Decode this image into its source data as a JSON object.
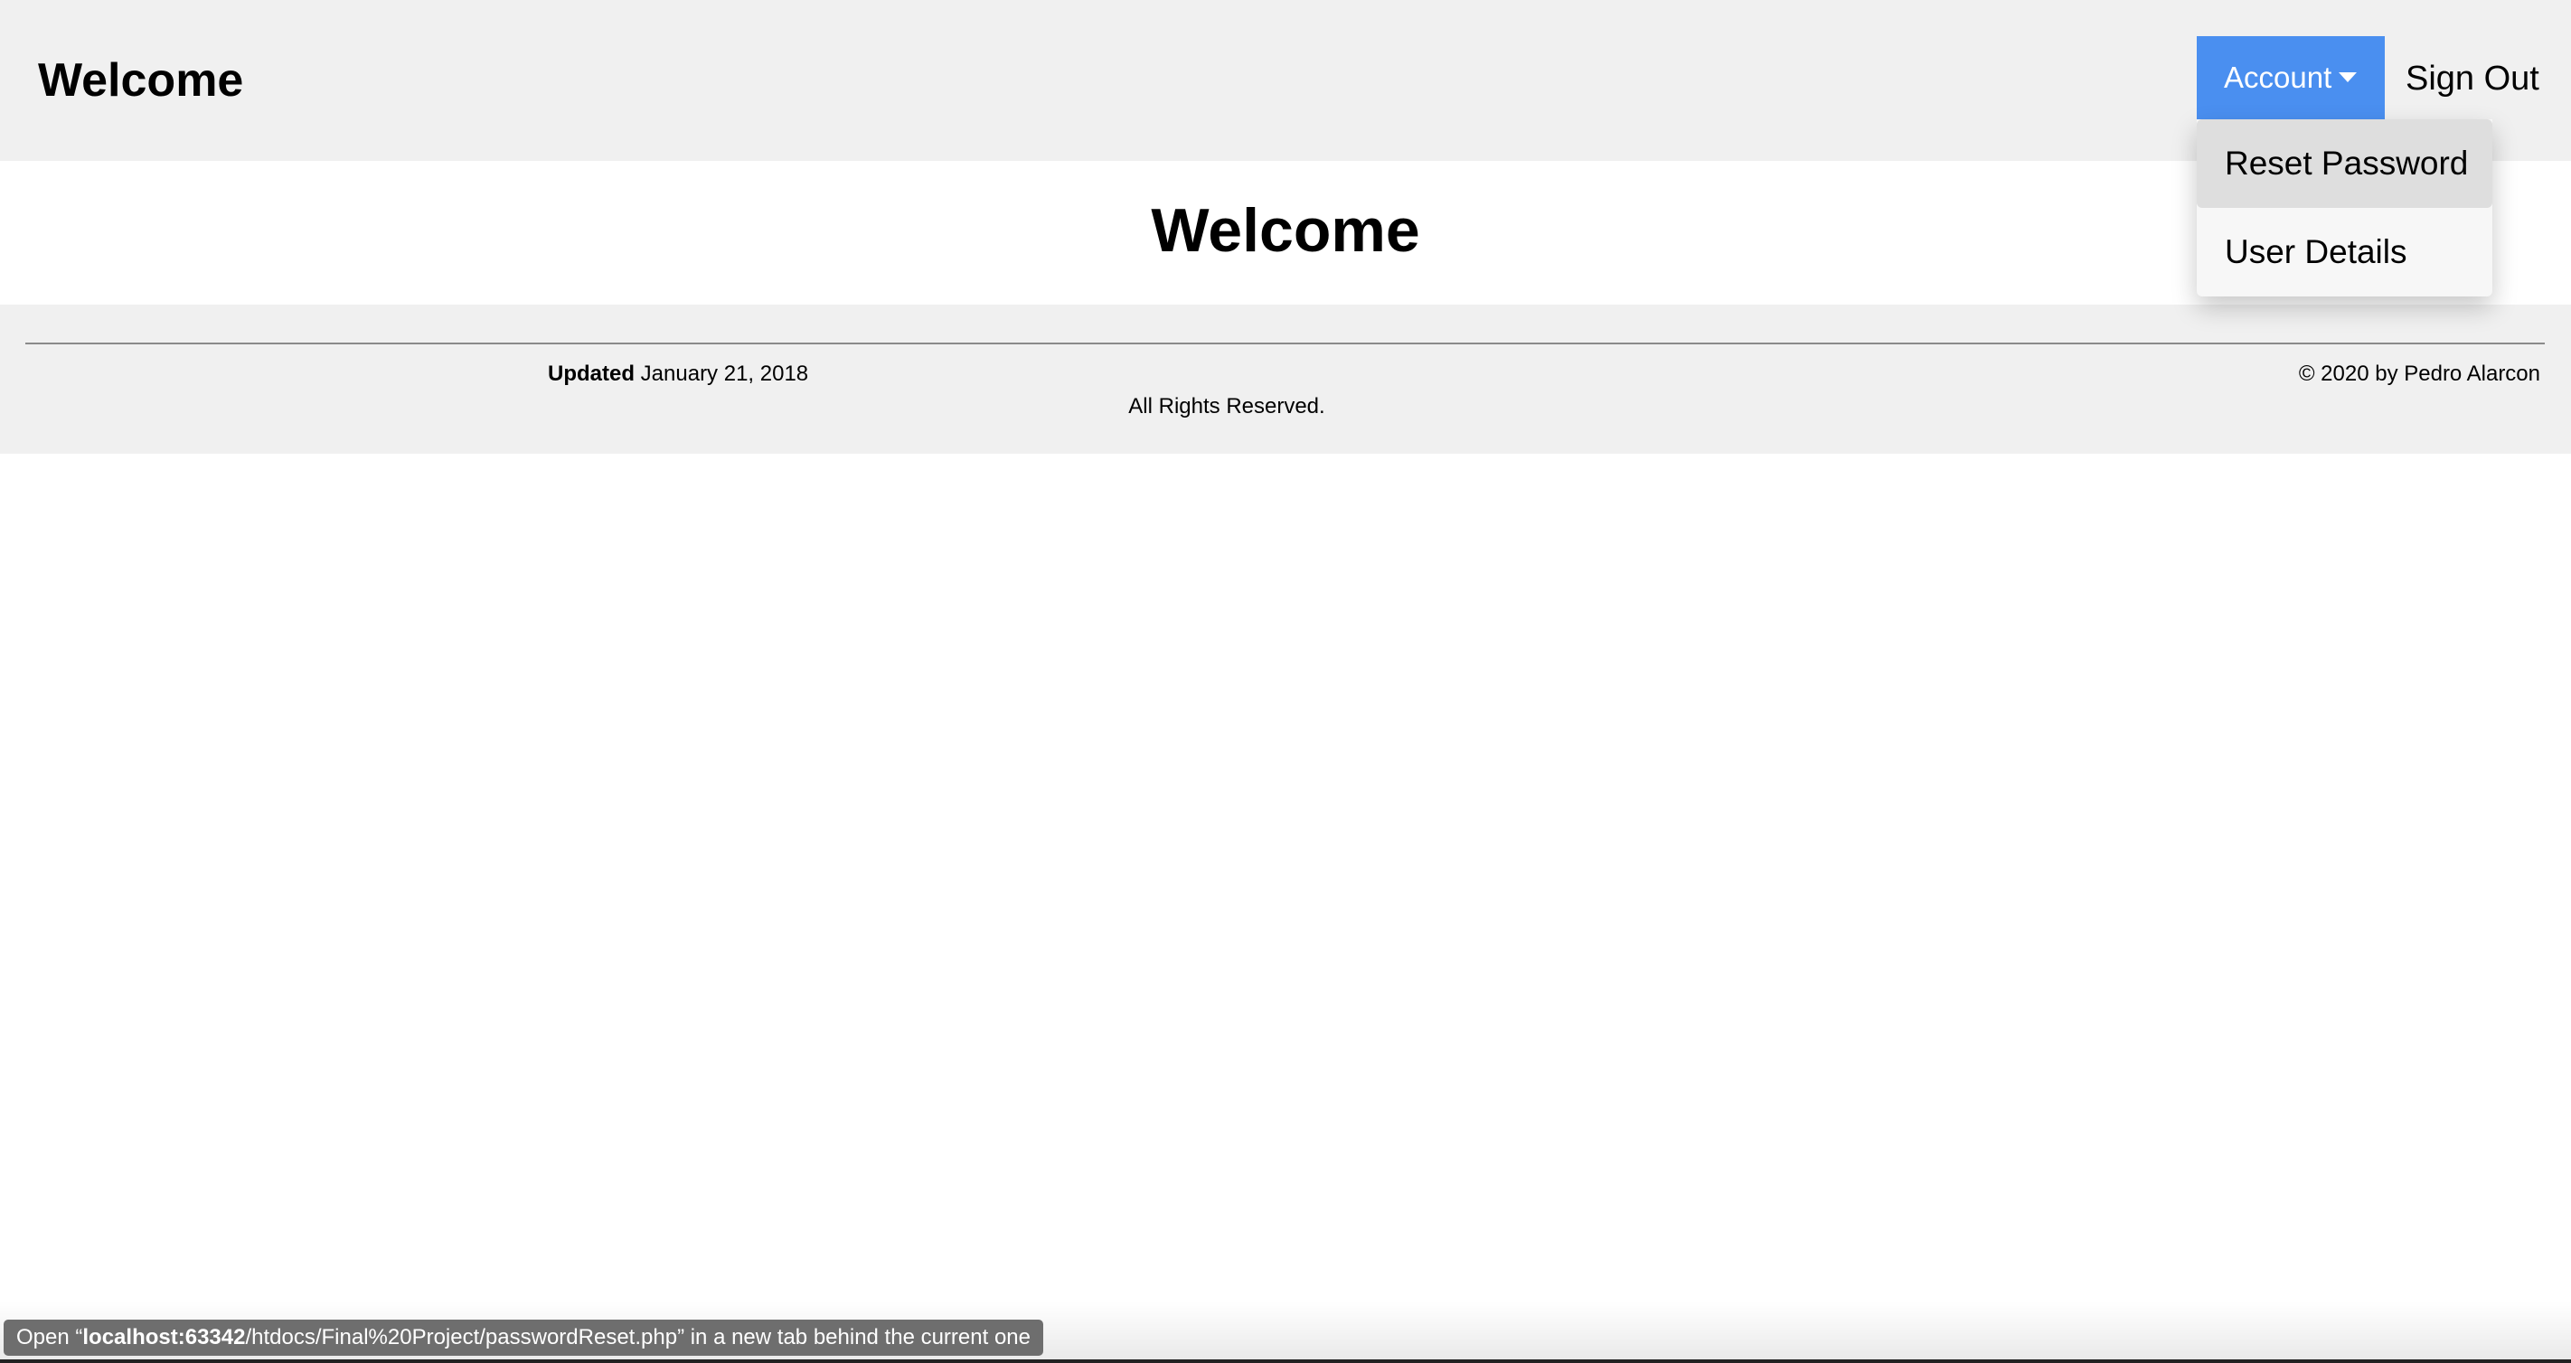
{
  "header": {
    "brand": "Welcome",
    "account_label": "Account",
    "account_caret_icon": "caret-down",
    "sign_out_label": "Sign Out",
    "accent_color": "#4a8ff0"
  },
  "account_menu": {
    "items": [
      {
        "label": "Reset Password",
        "hovered": true
      },
      {
        "label": "User Details",
        "hovered": false
      }
    ]
  },
  "main": {
    "title": "Welcome"
  },
  "footer": {
    "updated_label": "Updated",
    "updated_date": "January 21, 2018",
    "copyright": "© 2020 by Pedro Alarcon",
    "rights": "All Rights Reserved."
  },
  "status": {
    "prefix": "Open “",
    "host": "localhost:63342",
    "path": "/htdocs/Final%20Project/passwordReset.php",
    "suffix": "” in a new tab behind the current one"
  }
}
